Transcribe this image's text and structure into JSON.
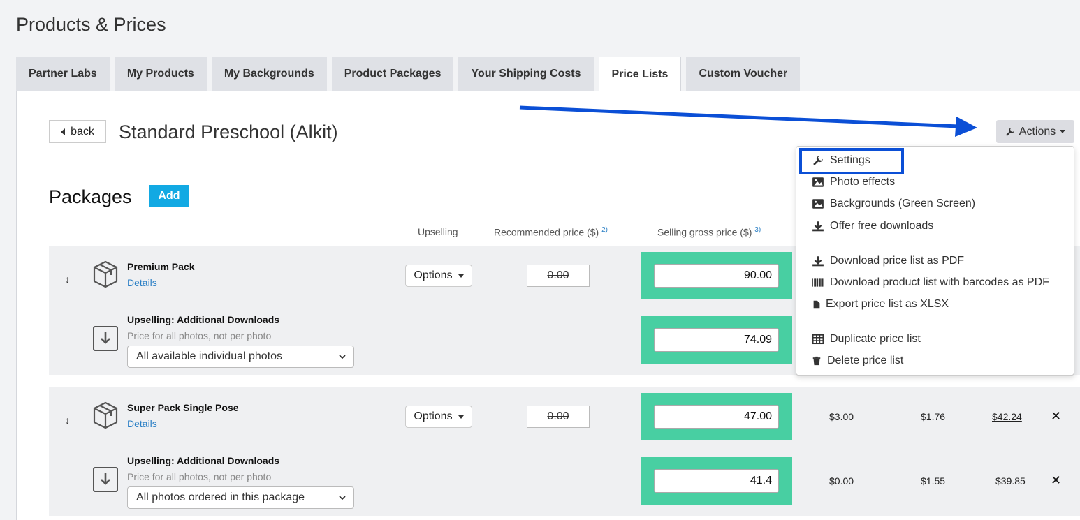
{
  "page": {
    "title": "Products & Prices"
  },
  "tabs": [
    {
      "label": "Partner Labs"
    },
    {
      "label": "My Products"
    },
    {
      "label": "My Backgrounds"
    },
    {
      "label": "Product Packages"
    },
    {
      "label": "Your Shipping Costs"
    },
    {
      "label": "Price Lists",
      "active": true
    },
    {
      "label": "Custom Voucher"
    }
  ],
  "toolbar": {
    "back_label": "back",
    "list_title": "Standard Preschool (Alkit)",
    "actions_label": "Actions"
  },
  "packages": {
    "heading": "Packages",
    "add_label": "Add",
    "columns": {
      "upselling": "Upselling",
      "recommended": "Recommended price ($)",
      "recommended_note": "2)",
      "selling": "Selling gross price ($)",
      "selling_note": "3)"
    },
    "items": [
      {
        "name": "Premium Pack",
        "details_label": "Details",
        "options_label": "Options",
        "recommended_price": "0.00",
        "selling_price": "90.00",
        "upsell": {
          "name": "Upselling: Additional Downloads",
          "subtitle": "Price for all photos, not per photo",
          "select_value": "All available individual photos",
          "selling_price": "74.09"
        }
      },
      {
        "name": "Super Pack Single Pose",
        "details_label": "Details",
        "options_label": "Options",
        "recommended_price": "0.00",
        "selling_price": "47.00",
        "col_a": "$3.00",
        "col_b": "$1.76",
        "col_c": "$42.24",
        "upsell": {
          "name": "Upselling: Additional Downloads",
          "subtitle": "Price for all photos, not per photo",
          "select_value": "All photos ordered in this package",
          "selling_price": "41.4",
          "col_a": "$0.00",
          "col_b": "$1.55",
          "col_c": "$39.85"
        }
      }
    ]
  },
  "actions_menu": {
    "items": [
      {
        "label": "Settings",
        "icon": "wrench-icon"
      },
      {
        "label": "Photo effects",
        "icon": "image-icon"
      },
      {
        "label": "Backgrounds (Green Screen)",
        "icon": "image-icon"
      },
      {
        "label": "Offer free downloads",
        "icon": "download-icon"
      },
      {
        "label": "Download price list as PDF",
        "icon": "download-icon"
      },
      {
        "label": "Download product list with barcodes as PDF",
        "icon": "barcode-icon"
      },
      {
        "label": "Export price list as XLSX",
        "icon": "file-icon"
      },
      {
        "label": "Duplicate price list",
        "icon": "table-icon"
      },
      {
        "label": "Delete price list",
        "icon": "trash-icon"
      }
    ]
  },
  "colors": {
    "accent": "#12a9e3",
    "price_cell": "#48cfa2",
    "annotation": "#0b4fd6",
    "link": "#2a7fc5"
  }
}
